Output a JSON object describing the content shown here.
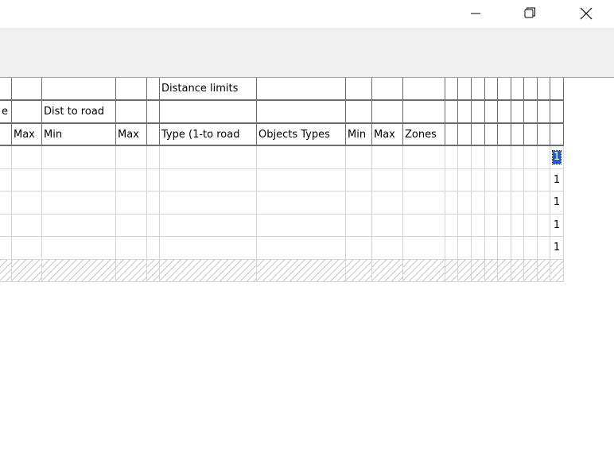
{
  "window": {
    "controls": [
      "minimize-icon",
      "restore-icon",
      "close-icon"
    ]
  },
  "grid": {
    "header_row1": [
      "",
      "",
      "",
      "",
      "",
      "Distance limits",
      "",
      "",
      "",
      "",
      "",
      "",
      "",
      "",
      "",
      "",
      "",
      "",
      "",
      ""
    ],
    "header_row2": [
      "e",
      "",
      "Dist to road",
      "",
      "",
      "",
      "",
      "",
      "",
      "",
      "",
      "",
      "",
      "",
      "",
      "",
      "",
      "",
      "",
      ""
    ],
    "header_row3": [
      "",
      "Max",
      "Min",
      "Max",
      "",
      "Type (1-to road",
      "Objects Types",
      "Min",
      "Max",
      "Zones",
      "",
      "",
      "",
      "",
      "",
      "",
      "",
      "",
      "",
      ""
    ],
    "row_values": [
      "1",
      "1",
      "1",
      "1",
      "1"
    ]
  },
  "colors": {
    "grid_line": "#d4d4d4",
    "header_line": "#6d6d6d",
    "toolbar_bg": "#f0f0f0",
    "selection": "#1c5fc7"
  }
}
